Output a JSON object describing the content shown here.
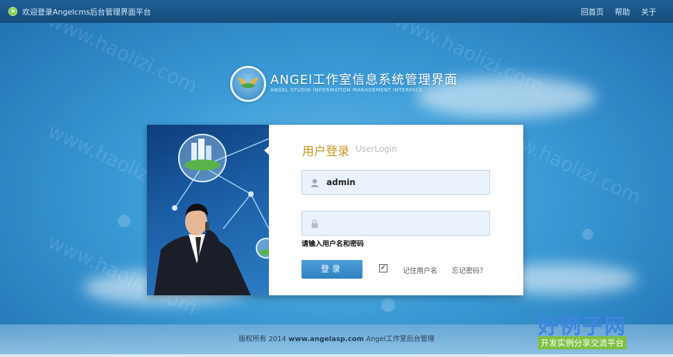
{
  "topbar": {
    "welcome": "欢迎登录Angelcms后台管理界面平台",
    "nav": [
      "回首页",
      "帮助",
      "关于"
    ]
  },
  "brand": {
    "title": "ANGEl工作室信息系统管理界面",
    "subtitle": "ANGEL STUDIO INFORMATION MANAGEMENT INTERFACE"
  },
  "login": {
    "title": "用户登录",
    "title_en": "UserLogin",
    "username_value": "admin",
    "password_value": "",
    "hint": "请输入用户名和密码",
    "submit_label": "登录",
    "remember_checked": true,
    "remember_mark": "✓",
    "remember_label": "记住用户名",
    "forgot_label": "忘记密码？"
  },
  "footer": {
    "prefix": "版权所有 2014 ",
    "site": "www.angelasp.com",
    "suffix": " Angel工作室后台管理"
  },
  "watermark": {
    "title": "好例子网",
    "tagline": "开发实例分享交流平台",
    "site_text": "www.haolizi.com"
  },
  "colors": {
    "accent_gold": "#c89420",
    "button_blue": "#2f81c1",
    "topbar": "#1f5f96"
  },
  "icons": [
    "play-icon",
    "user-icon",
    "lock-icon",
    "checkbox-icon"
  ]
}
